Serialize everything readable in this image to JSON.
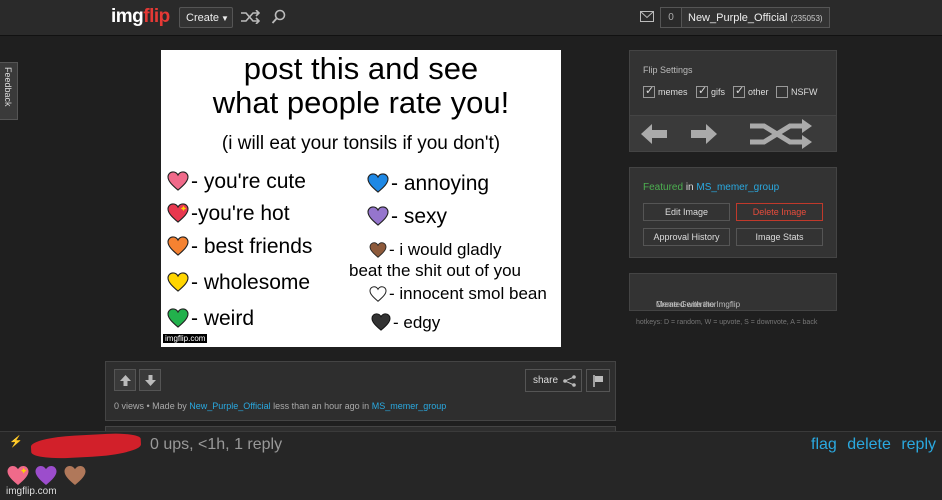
{
  "header": {
    "logo_part1": "img",
    "logo_part2": "flip",
    "create_label": "Create",
    "notif_count": "0",
    "username": "New_Purple_Official",
    "points": "(235053)"
  },
  "feedback_label": "Feedback",
  "meme": {
    "title_line1": "post this and see",
    "title_line2": "what people rate you!",
    "subtitle": "(i will eat your tonsils if you don't)",
    "items": [
      {
        "text": "- you're cute",
        "color": "#f06a8a"
      },
      {
        "text": "-you're hot",
        "color": "#e8384f"
      },
      {
        "text": "- best friends",
        "color": "#f58231"
      },
      {
        "text": "- wholesome",
        "color": "#ffd500"
      },
      {
        "text": "- weird",
        "color": "#22b14c"
      },
      {
        "text": "- annoying",
        "color": "#1e88e5"
      },
      {
        "text": "- sexy",
        "color": "#9575cd"
      },
      {
        "text": "- i would gladly",
        "color": "#8d5a3b"
      },
      {
        "text": "beat the shit out of you",
        "color": ""
      },
      {
        "text": "- innocent smol bean",
        "color": "#ffffff"
      },
      {
        "text": "- edgy",
        "color": "#333333"
      }
    ],
    "watermark": "imgflip.com"
  },
  "infobar": {
    "share_label": "share",
    "views": "0 views",
    "made_by_prefix": "• Made by",
    "author": "New_Purple_Official",
    "time_text": "less than an hour ago in",
    "stream": "MS_memer_group"
  },
  "flip_settings": {
    "title": "Flip Settings",
    "options": [
      {
        "label": "memes",
        "checked": true
      },
      {
        "label": "gifs",
        "checked": true
      },
      {
        "label": "other",
        "checked": true
      },
      {
        "label": "NSFW",
        "checked": false
      }
    ]
  },
  "featured": {
    "prefix": "Featured",
    "in": "in",
    "stream": "MS_memer_group",
    "buttons": [
      "Edit Image",
      "Delete Image",
      "Approval History",
      "Image Stats"
    ]
  },
  "created": {
    "prefix": "Created with the Imgflip",
    "link": "Meme Generator"
  },
  "hotkeys": "hotkeys: D = random, W = upvote, S = downvote, A = back",
  "comment": {
    "stats": "0 ups, <1h, 1 reply",
    "actions": [
      "flag",
      "delete",
      "reply"
    ],
    "watermark": "imgflip.com"
  },
  "colors": {
    "accent_link": "#2aa9e0",
    "featured_green": "#4caf50",
    "danger": "#e74c3c",
    "logo_red": "#e53935"
  }
}
